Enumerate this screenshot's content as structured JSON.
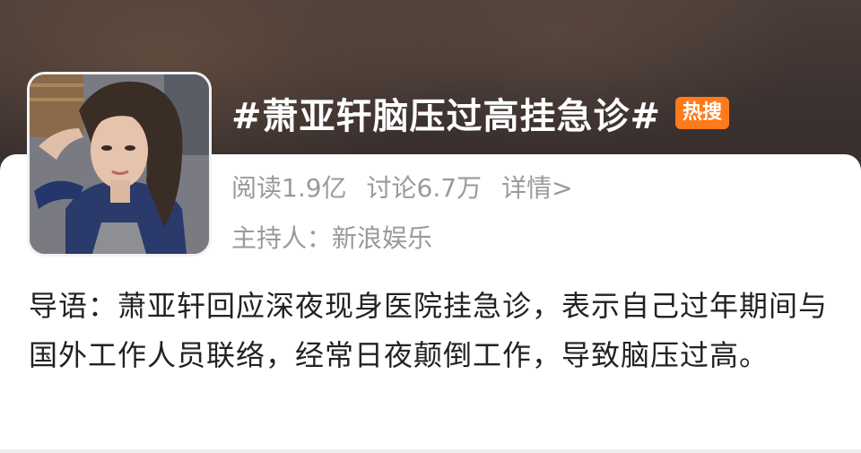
{
  "topic": {
    "title": "#萧亚轩脑压过高挂急诊#",
    "badge": "热搜"
  },
  "stats": {
    "reads": "阅读1.9亿",
    "discussions": "讨论6.7万",
    "details_link": "详情>"
  },
  "host": {
    "label": "主持人：新浪娱乐"
  },
  "intro": {
    "text": "导语：萧亚轩回应深夜现身医院挂急诊，表示自己过年期间与国外工作人员联络，经常日夜颠倒工作，导致脑压过高。"
  },
  "colors": {
    "badge_bg": "#ff7a1a",
    "secondary_text": "#9a9a9a",
    "body_text": "#222222"
  }
}
